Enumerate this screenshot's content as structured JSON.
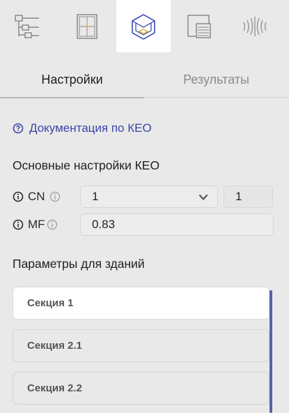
{
  "toolbar": {
    "tools": [
      {
        "icon": "tree-structure-icon",
        "active": false
      },
      {
        "icon": "window-grid-icon",
        "active": false
      },
      {
        "icon": "room-3d-icon",
        "active": true
      },
      {
        "icon": "layers-icon",
        "active": false
      },
      {
        "icon": "sound-waves-icon",
        "active": false
      }
    ]
  },
  "tabs": {
    "settings_label": "Настройки",
    "results_label": "Результаты"
  },
  "doc_link": {
    "label": "Документация по КЕО"
  },
  "main_settings": {
    "title": "Основные настройки КЕО",
    "cn_label": "CN",
    "cn_select_value": "1",
    "cn_value": "1",
    "mf_label": "MF",
    "mf_value": "0.83"
  },
  "buildings": {
    "title": "Параметры для зданий",
    "sections": [
      {
        "label": "Секция 1"
      },
      {
        "label": "Секция 2.1"
      },
      {
        "label": "Секция 2.2"
      }
    ]
  },
  "colors": {
    "accent": "#3b46a8",
    "icon_active": "#2f3fb0",
    "icon_highlight": "#e3b22b",
    "scroll": "#5a61a8"
  }
}
